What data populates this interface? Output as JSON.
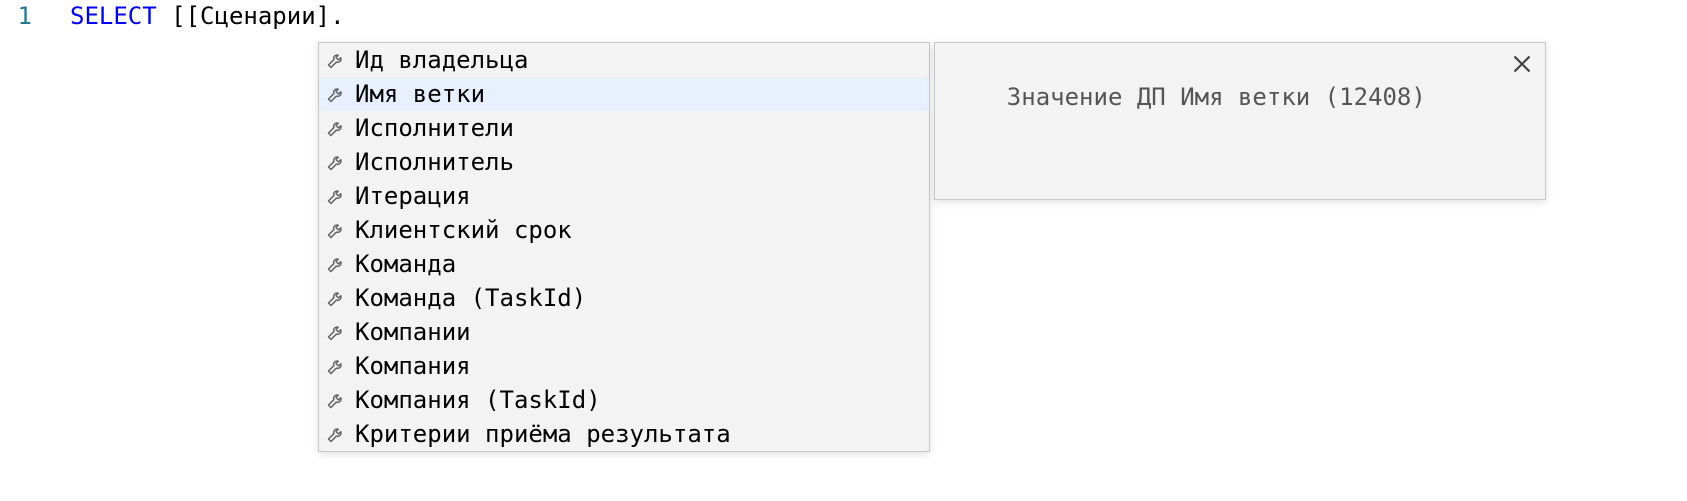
{
  "editor": {
    "line_number": "1",
    "code": {
      "keyword": "SELECT",
      "rest": " [[Сценарии]."
    }
  },
  "completion": {
    "selected_index": 1,
    "items": [
      {
        "label": "Ид владельца"
      },
      {
        "label": "Имя ветки"
      },
      {
        "label": "Исполнители"
      },
      {
        "label": "Исполнитель"
      },
      {
        "label": "Итерация"
      },
      {
        "label": "Клиентский срок"
      },
      {
        "label": "Команда"
      },
      {
        "label": "Команда (TaskId)"
      },
      {
        "label": "Компании"
      },
      {
        "label": "Компания"
      },
      {
        "label": "Компания (TaskId)"
      },
      {
        "label": "Критерии приёма результата"
      }
    ]
  },
  "details": {
    "text": "Значение ДП Имя ветки (12408)",
    "close_label": "×"
  }
}
